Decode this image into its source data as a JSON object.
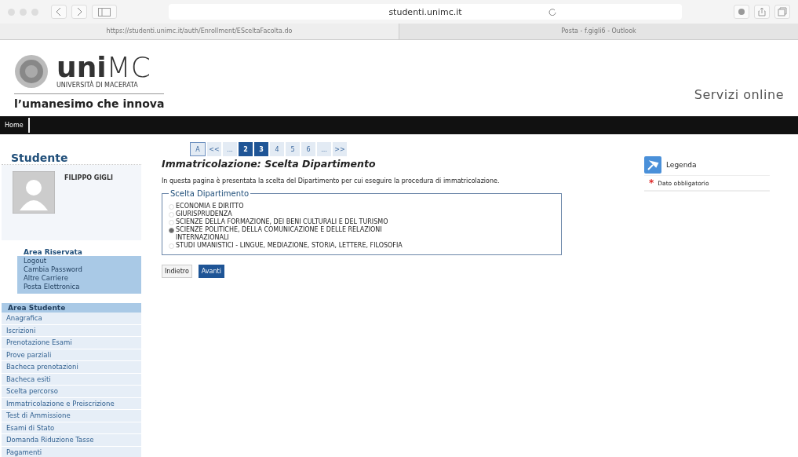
{
  "browser": {
    "address": "studenti.unimc.it",
    "tabs": [
      {
        "label": "https://studenti.unimc.it/auth/Enrollment/ESceltaFacolta.do",
        "selected": true
      },
      {
        "label": "Posta - f.gigli6 - Outlook",
        "selected": false
      }
    ]
  },
  "header": {
    "logo_main": "uni",
    "logo_suffix": "MC",
    "logo_subtitle": "UNIVERSITÀ DI MACERATA",
    "tagline": "l’umanesimo che innova",
    "services": "Servizi online"
  },
  "navbar": {
    "items": [
      "Home"
    ]
  },
  "sidebar": {
    "title": "Studente",
    "user_name": "FILIPPO GIGLI",
    "reserved_area": {
      "title": "Area Riservata",
      "items": [
        "Logout",
        "Cambia Password",
        "Altre Carriere",
        "Posta Elettronica"
      ]
    },
    "student_area": {
      "title": "Area Studente",
      "items": [
        "Anagrafica",
        "Iscrizioni",
        "Prenotazione Esami",
        "Prove parziali",
        "Bacheca prenotazioni",
        "Bacheca esiti",
        "Scelta percorso",
        "Immatricolazione e Preiscrizione",
        "Test di Ammissione",
        "Esami di Stato",
        "Domanda Riduzione Tasse",
        "Pagamenti"
      ]
    }
  },
  "steps": [
    {
      "label": "A",
      "kind": "legend",
      "selected": false
    },
    {
      "label": "<<",
      "kind": "step",
      "selected": false
    },
    {
      "label": "...",
      "kind": "step",
      "selected": false
    },
    {
      "label": "2",
      "kind": "step",
      "selected": true
    },
    {
      "label": "3",
      "kind": "step",
      "selected": true
    },
    {
      "label": "4",
      "kind": "step",
      "selected": false
    },
    {
      "label": "5",
      "kind": "step",
      "selected": false
    },
    {
      "label": "6",
      "kind": "step",
      "selected": false
    },
    {
      "label": "...",
      "kind": "step",
      "selected": false
    },
    {
      "label": ">>",
      "kind": "step",
      "selected": false
    }
  ],
  "page": {
    "title": "Immatricolazione: Scelta Dipartimento",
    "description": "In questa pagina è presentata la scelta del Dipartimento per cui eseguire la procedura di immatricolazione.",
    "fieldset": {
      "legend": "Scelta Dipartimento",
      "options": [
        {
          "label": "ECONOMIA E DIRITTO",
          "selected": false
        },
        {
          "label": "GIURISPRUDENZA",
          "selected": false
        },
        {
          "label": "SCIENZE DELLA FORMAZIONE, DEI BENI CULTURALI E DEL TURISMO",
          "selected": false
        },
        {
          "label": "SCIENZE POLITICHE, DELLA COMUNICAZIONE E DELLE RELAZIONI INTERNAZIONALI",
          "selected": true
        },
        {
          "label": "STUDI UMANISTICI - LINGUE, MEDIAZIONE, STORIA, LETTERE, FILOSOFIA",
          "selected": false
        }
      ]
    },
    "buttons": [
      {
        "label": "Indietro",
        "kind": "secondary"
      },
      {
        "label": "Avanti",
        "kind": "primary"
      }
    ]
  },
  "legend": {
    "title": "Legenda",
    "items": [
      {
        "label": "Dato obbligatorio",
        "mark": "*"
      }
    ]
  }
}
